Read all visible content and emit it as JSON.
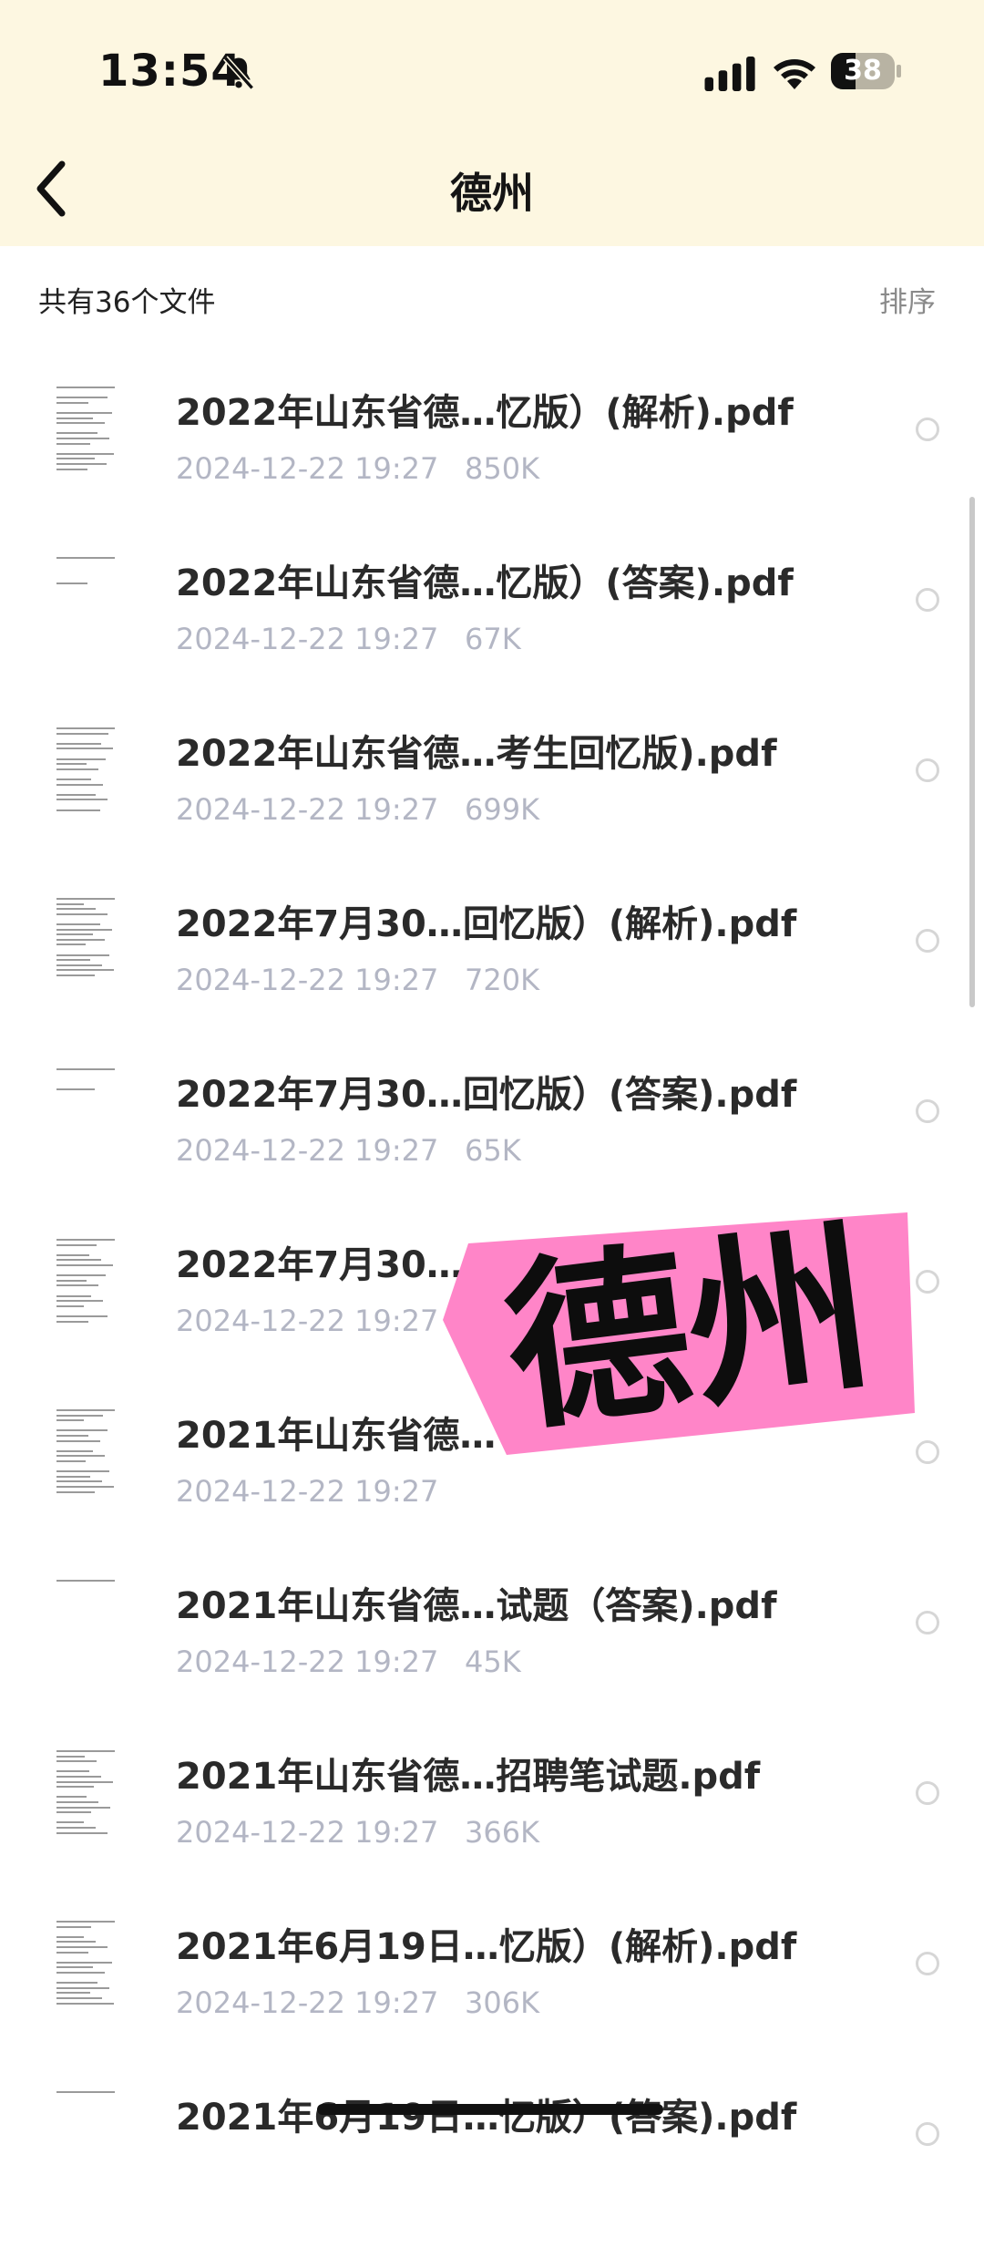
{
  "status_bar": {
    "time": "13:54",
    "battery_level": "38",
    "battery_fraction": 0.38,
    "icons": [
      "bell-slash-icon",
      "signal-icon",
      "wifi-icon",
      "battery-icon"
    ]
  },
  "nav": {
    "back_icon": "chevron-left-icon",
    "title": "德州"
  },
  "toolbar": {
    "file_count": "共有36个文件",
    "sort_label": "排序"
  },
  "files": [
    {
      "name": "2022年山东省德…忆版）(解析).pdf",
      "date": "2024-12-22 19:27",
      "size": "850K"
    },
    {
      "name": "2022年山东省德…忆版）(答案).pdf",
      "date": "2024-12-22 19:27",
      "size": "67K"
    },
    {
      "name": "2022年山东省德…考生回忆版).pdf",
      "date": "2024-12-22 19:27",
      "size": "699K"
    },
    {
      "name": "2022年7月30…回忆版）(解析).pdf",
      "date": "2024-12-22 19:27",
      "size": "720K"
    },
    {
      "name": "2022年7月30…回忆版）(答案).pdf",
      "date": "2024-12-22 19:27",
      "size": "65K"
    },
    {
      "name": "2022年7月30…",
      "date": "2024-12-22 19:27",
      "size": ""
    },
    {
      "name": "2021年山东省德…",
      "date": "2024-12-22 19:27",
      "size": ""
    },
    {
      "name": "2021年山东省德…试题（答案).pdf",
      "date": "2024-12-22 19:27",
      "size": "45K"
    },
    {
      "name": "2021年山东省德…招聘笔试题.pdf",
      "date": "2024-12-22 19:27",
      "size": "366K"
    },
    {
      "name": "2021年6月19日…忆版）(解析).pdf",
      "date": "2024-12-22 19:27",
      "size": "306K"
    },
    {
      "name": "2021年6月19日…忆版）(答案).pdf",
      "date": "",
      "size": ""
    }
  ],
  "sticker": {
    "text": "德州",
    "color": "#ff85c8"
  },
  "colors": {
    "header_bg": "#fdf7e1",
    "meta_text": "#b3b6c4"
  }
}
